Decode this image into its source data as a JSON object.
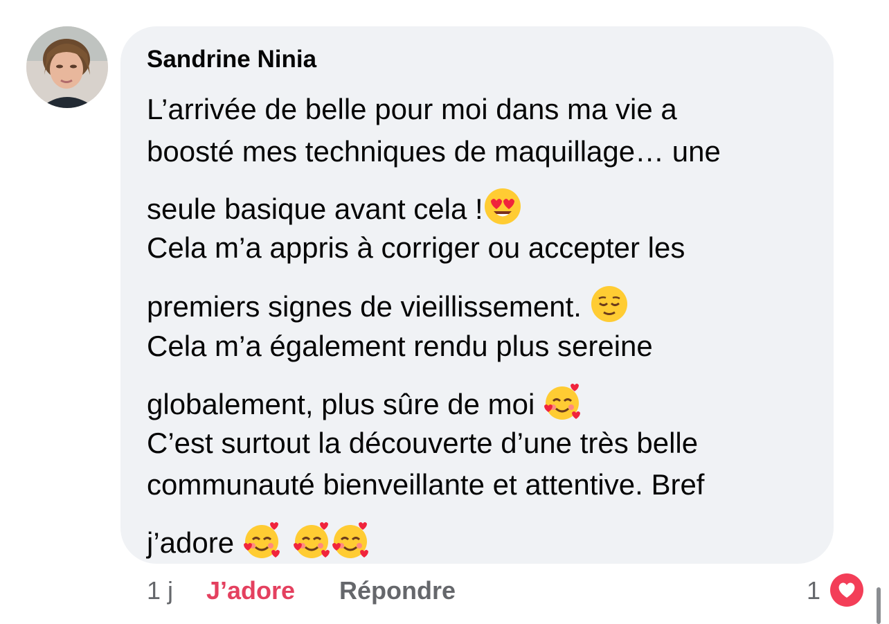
{
  "comment": {
    "author": "Sandrine Ninia",
    "lines": [
      "L’arrivée de belle pour moi dans ma vie a",
      "boosté mes techniques de maquillage… une",
      "seule basique avant cela !",
      "Cela m’a appris à corriger ou accepter les",
      "premiers signes de vieillissement. ",
      "Cela m’a également rendu plus sereine",
      "globalement, plus sûre de moi ",
      "C’est surtout la découverte d’une très belle",
      "communauté bienveillante et attentive. Bref",
      "j’adore "
    ],
    "emojis": {
      "line3": "heart-eyes-emoji",
      "line5": "relieved-face-emoji",
      "line7": "smiling-face-with-hearts-emoji",
      "line10": [
        "smiling-face-with-hearts-emoji",
        "smiling-face-with-hearts-emoji",
        "smiling-face-with-hearts-emoji"
      ]
    }
  },
  "footer": {
    "time": "1 j",
    "love_label": "J’adore",
    "reply_label": "Répondre",
    "reaction_count": "1",
    "reaction_icon": "heart-reaction-icon"
  },
  "colors": {
    "bubble": "#f0f2f5",
    "love": "#e4405f",
    "muted": "#65676b",
    "heart": "#f33e58"
  }
}
